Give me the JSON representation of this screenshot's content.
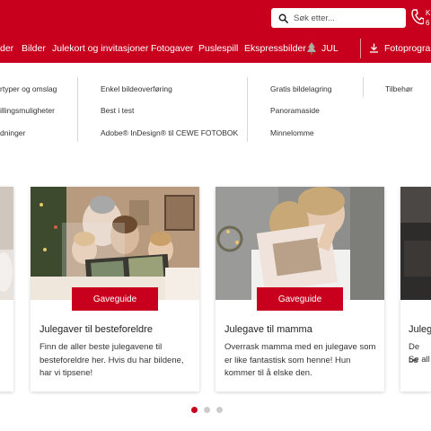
{
  "header": {
    "search_placeholder": "Søk etter...",
    "phone_text_1": "K",
    "phone_text_2": "6",
    "nav": [
      {
        "label": "der"
      },
      {
        "label": "Bilder"
      },
      {
        "label": "Julekort og invitasjoner"
      },
      {
        "label": "Fotogaver"
      },
      {
        "label": "Puslespill"
      },
      {
        "label": "Ekspressbilder"
      },
      {
        "label": "JUL"
      },
      {
        "label": "Fotoprogram"
      }
    ]
  },
  "menu": {
    "col1": [
      "rtyper og omslag",
      "illingsmuligheter",
      "dninger"
    ],
    "col2": [
      "Enkel bildeoverføring",
      "Best i test",
      "Adobe® InDesign® til CEWE FOTOBOK"
    ],
    "col3": [
      "Gratis bildelagring",
      "Panoramaside",
      "Minnelomme"
    ],
    "col4": [
      "Tilbehør"
    ]
  },
  "cards": [
    {
      "badge": "Gaveguide",
      "title": "Julegaver til besteforeldre",
      "text": "Finn de aller beste julegavene til besteforeldre her. Hvis du har bildene, har vi tipsene!"
    },
    {
      "badge": "Gaveguide",
      "title": "Julegave til mamma",
      "text": "Overrask mamma med en julegave som er like fantastisk som henne! Hun kommer til å elske den."
    }
  ],
  "partial_left": {
    "line1": ":",
    "line2": ""
  },
  "partial_right": {
    "title": "Juleg",
    "line1": "De be",
    "line2": "Se all"
  },
  "carousel": {
    "dots": 3,
    "active": 1
  },
  "colors": {
    "brand": "#c8001d"
  }
}
